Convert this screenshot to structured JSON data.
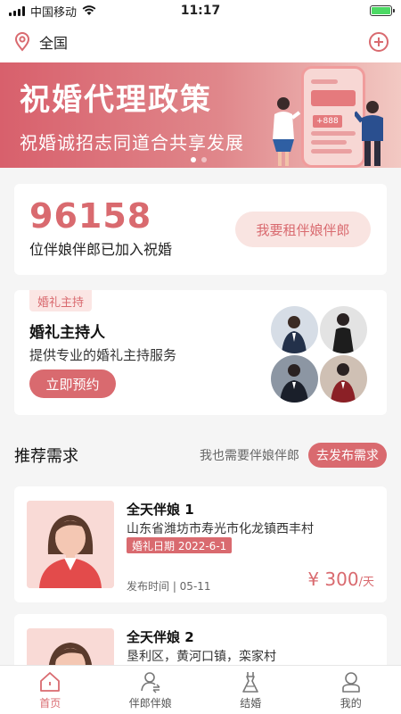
{
  "status": {
    "carrier": "中国移动",
    "time": "11:17"
  },
  "header": {
    "location": "全国"
  },
  "banner": {
    "title": "祝婚代理政策",
    "subtitle": "祝婚诚招志同道合共享发展",
    "phone_amount": "+888"
  },
  "stats": {
    "number": "96158",
    "label": "位伴娘伴郎已加入祝婚",
    "rent_button": "我要租伴娘伴郎"
  },
  "host": {
    "tag": "婚礼主持",
    "title": "婚礼主持人",
    "desc": "提供专业的婚礼主持服务",
    "book_button": "立即预约"
  },
  "section": {
    "title": "推荐需求",
    "hint": "我也需要伴娘伴郎",
    "publish_button": "去发布需求"
  },
  "requests": [
    {
      "name": "全天伴娘 1",
      "address": "山东省潍坊市寿光市化龙镇西丰村",
      "date": "婚礼日期 2022-6-1",
      "publish_time": "发布时间 | 05-11",
      "price": "¥ 300",
      "unit": "/天"
    },
    {
      "name": "全天伴娘 2",
      "address": "垦利区，黄河口镇，栾家村",
      "date": "",
      "publish_time": "",
      "price": "",
      "unit": ""
    }
  ],
  "tabs": [
    {
      "label": "首页",
      "icon": "home-icon"
    },
    {
      "label": "伴郎伴娘",
      "icon": "person-swap-icon"
    },
    {
      "label": "结婚",
      "icon": "wedding-dress-icon"
    },
    {
      "label": "我的",
      "icon": "profile-icon"
    }
  ],
  "colors": {
    "accent": "#d96a6f",
    "accent_light": "#f9e4e1",
    "background": "#f5f5f5"
  }
}
